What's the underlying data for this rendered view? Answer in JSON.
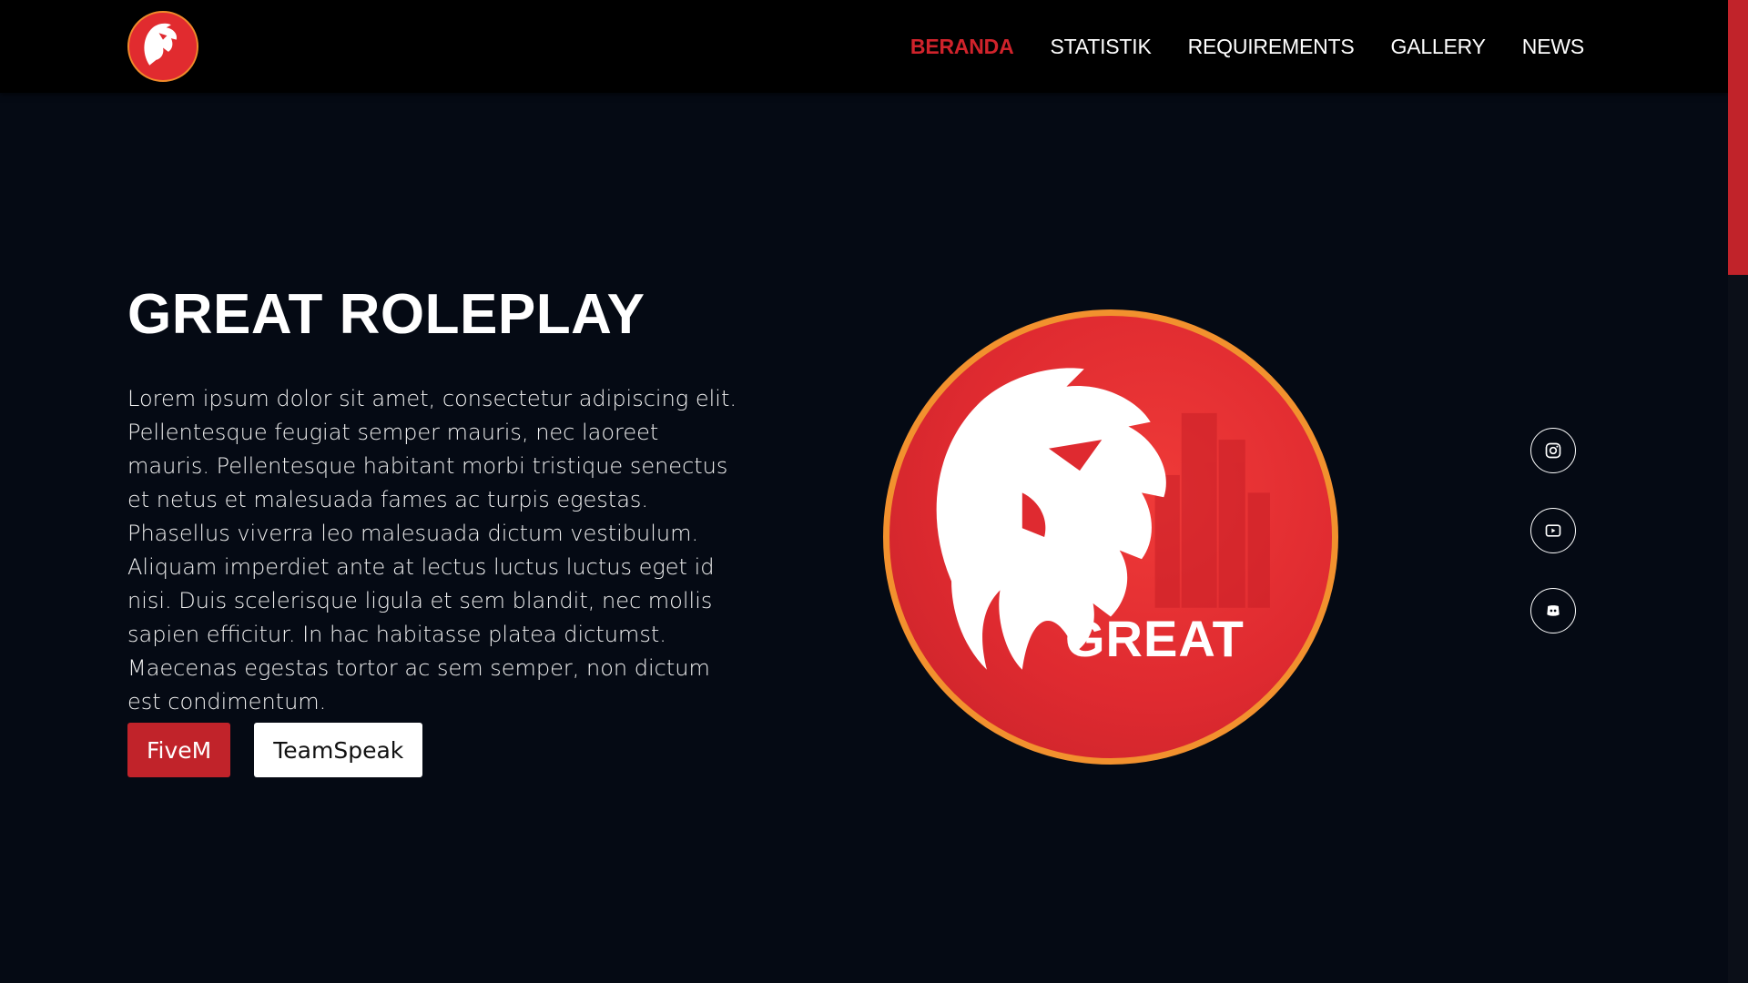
{
  "header": {
    "logo_text": "GREAT",
    "nav": [
      {
        "label": "BERANDA",
        "active": true
      },
      {
        "label": "STATISTIK",
        "active": false
      },
      {
        "label": "REQUIREMENTS",
        "active": false
      },
      {
        "label": "GALLERY",
        "active": false
      },
      {
        "label": "NEWS",
        "active": false
      }
    ]
  },
  "hero": {
    "title": "GREAT ROLEPLAY",
    "description": "Lorem ipsum dolor sit amet, consectetur adipiscing elit. Pellentesque feugiat semper mauris, nec laoreet mauris. Pellentesque habitant morbi tristique senectus et netus et malesuada fames ac turpis egestas. Phasellus viverra leo malesuada dictum vestibulum. Aliquam imperdiet ante at lectus luctus luctus eget id nisi. Duis scelerisque ligula et sem blandit, nec mollis sapien efficitur. In hac habitasse platea dictumst. Maecenas egestas tortor ac sem semper, non dictum est condimentum.",
    "buttons": {
      "primary": "FiveM",
      "secondary": "TeamSpeak"
    },
    "logo_text": "GREAT"
  },
  "social": [
    {
      "icon": "instagram-icon"
    },
    {
      "icon": "youtube-icon"
    },
    {
      "icon": "discord-icon"
    }
  ],
  "colors": {
    "background": "#050a14",
    "header": "#000000",
    "accent": "#c1232a",
    "logo_red": "#df2a30",
    "logo_ring": "#f2912e"
  }
}
